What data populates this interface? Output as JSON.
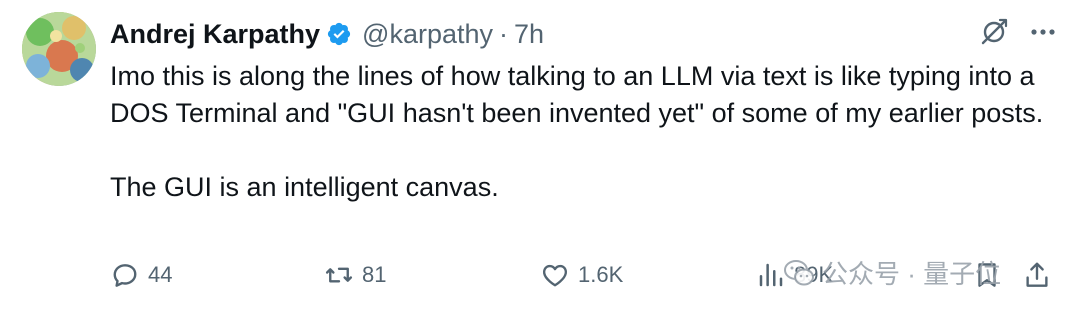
{
  "author": {
    "name": "Andrej Karpathy",
    "handle": "@karpathy",
    "separator": "·",
    "time": "7h"
  },
  "tweet": {
    "paragraph1": "Imo this is along the lines of how talking to an LLM via text is like typing into a DOS Terminal and \"GUI hasn't been invented yet\" of some of my earlier posts.",
    "paragraph2": "The GUI is an intelligent canvas."
  },
  "actions": {
    "replies": "44",
    "reposts": "81",
    "likes": "1.6K",
    "views": "89K"
  },
  "watermark": {
    "text": "公众号 · 量子位"
  },
  "colors": {
    "verified": "#1d9bf0",
    "muted": "#536471",
    "text": "#0f1419"
  },
  "icons": [
    "verified-badge-icon",
    "grok-icon",
    "more-icon",
    "reply-icon",
    "repost-icon",
    "like-icon",
    "views-icon",
    "bookmark-icon",
    "share-icon",
    "wechat-icon"
  ]
}
